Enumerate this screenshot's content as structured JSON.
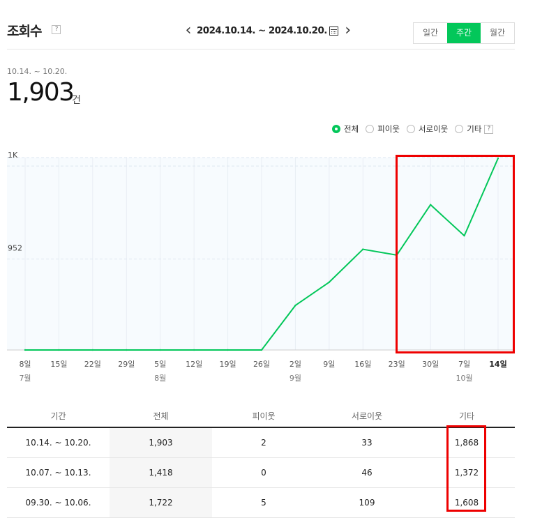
{
  "header": {
    "title": "조회수",
    "help_glyph": "?",
    "date_range": "2024.10.14. ~ 2024.10.20.",
    "prev_label": "‹",
    "next_label": "›",
    "period_tabs": [
      {
        "label": "일간",
        "active": false
      },
      {
        "label": "주간",
        "active": true
      },
      {
        "label": "월간",
        "active": false
      }
    ]
  },
  "summary": {
    "range": "10.14. ~ 10.20.",
    "total": "1,903",
    "unit": "건"
  },
  "filters": [
    {
      "label": "전체",
      "selected": true
    },
    {
      "label": "피이웃",
      "selected": false
    },
    {
      "label": "서로이웃",
      "selected": false
    },
    {
      "label": "기타",
      "selected": false
    }
  ],
  "colors": {
    "accent": "#03c75a",
    "highlight": "#e00000"
  },
  "chart_data": {
    "type": "line",
    "title": "",
    "y_ticks": [
      {
        "value": 1000,
        "label": "1K"
      },
      {
        "value": 952,
        "label": "952"
      }
    ],
    "x_tick_labels": [
      "8일",
      "15일",
      "22일",
      "29일",
      "5일",
      "12일",
      "19일",
      "26일",
      "2일",
      "9일",
      "16일",
      "23일",
      "30일",
      "7일",
      "14일"
    ],
    "month_labels": [
      {
        "at_index": 0,
        "label": "7월"
      },
      {
        "at_index": 4,
        "label": "8월"
      },
      {
        "at_index": 8,
        "label": "9월"
      },
      {
        "at_index": 13,
        "label": "10월"
      }
    ],
    "series": [
      {
        "values": [
          905,
          905,
          905,
          905,
          905,
          905,
          905,
          905,
          928,
          940,
          957,
          954,
          980,
          964,
          1004
        ]
      }
    ],
    "ylim": [
      905,
      1004
    ]
  },
  "table": {
    "headers": [
      "기간",
      "전체",
      "피이웃",
      "서로이웃",
      "기타"
    ],
    "rows": [
      [
        "10.14. ~ 10.20.",
        "1,903",
        "2",
        "33",
        "1,868"
      ],
      [
        "10.07. ~ 10.13.",
        "1,418",
        "0",
        "46",
        "1,372"
      ],
      [
        "09.30. ~ 10.06.",
        "1,722",
        "5",
        "109",
        "1,608"
      ]
    ]
  }
}
